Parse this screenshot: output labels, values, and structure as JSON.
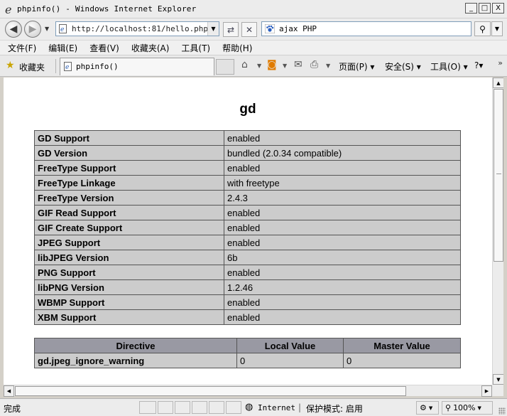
{
  "window": {
    "title": "phpinfo() - Windows Internet Explorer",
    "buttons": {
      "minimize": "_",
      "maximize": "□",
      "close": "X"
    }
  },
  "addressbar": {
    "url": "http://localhost:81/hello.php",
    "search_text": "ajax PHP"
  },
  "menubar": {
    "items": [
      "文件(F)",
      "编辑(E)",
      "查看(V)",
      "收藏夹(A)",
      "工具(T)",
      "帮助(H)"
    ]
  },
  "favbar": {
    "favorites_label": "收藏夹",
    "tab_title": "phpinfo()",
    "commands": {
      "page": "页面(P) ▾",
      "safety": "安全(S) ▾",
      "tools": "工具(O) ▾",
      "help": "?▾",
      "chevron": "»"
    }
  },
  "page": {
    "heading": "gd",
    "gd_rows": [
      {
        "name": "GD Support",
        "value": "enabled"
      },
      {
        "name": "GD Version",
        "value": "bundled (2.0.34 compatible)"
      },
      {
        "name": "FreeType Support",
        "value": "enabled"
      },
      {
        "name": "FreeType Linkage",
        "value": "with freetype"
      },
      {
        "name": "FreeType Version",
        "value": "2.4.3"
      },
      {
        "name": "GIF Read Support",
        "value": "enabled"
      },
      {
        "name": "GIF Create Support",
        "value": "enabled"
      },
      {
        "name": "JPEG Support",
        "value": "enabled"
      },
      {
        "name": "libJPEG Version",
        "value": "6b"
      },
      {
        "name": "PNG Support",
        "value": "enabled"
      },
      {
        "name": "libPNG Version",
        "value": "1.2.46"
      },
      {
        "name": "WBMP Support",
        "value": "enabled"
      },
      {
        "name": "XBM Support",
        "value": "enabled"
      }
    ],
    "directive_headers": [
      "Directive",
      "Local Value",
      "Master Value"
    ],
    "directive_rows": [
      {
        "directive": "gd.jpeg_ignore_warning",
        "local": "0",
        "master": "0"
      }
    ]
  },
  "statusbar": {
    "status": "完成",
    "zone": "Internet",
    "separator": "|",
    "protected_mode": "保护模式: 启用",
    "zoom": "100%"
  }
}
